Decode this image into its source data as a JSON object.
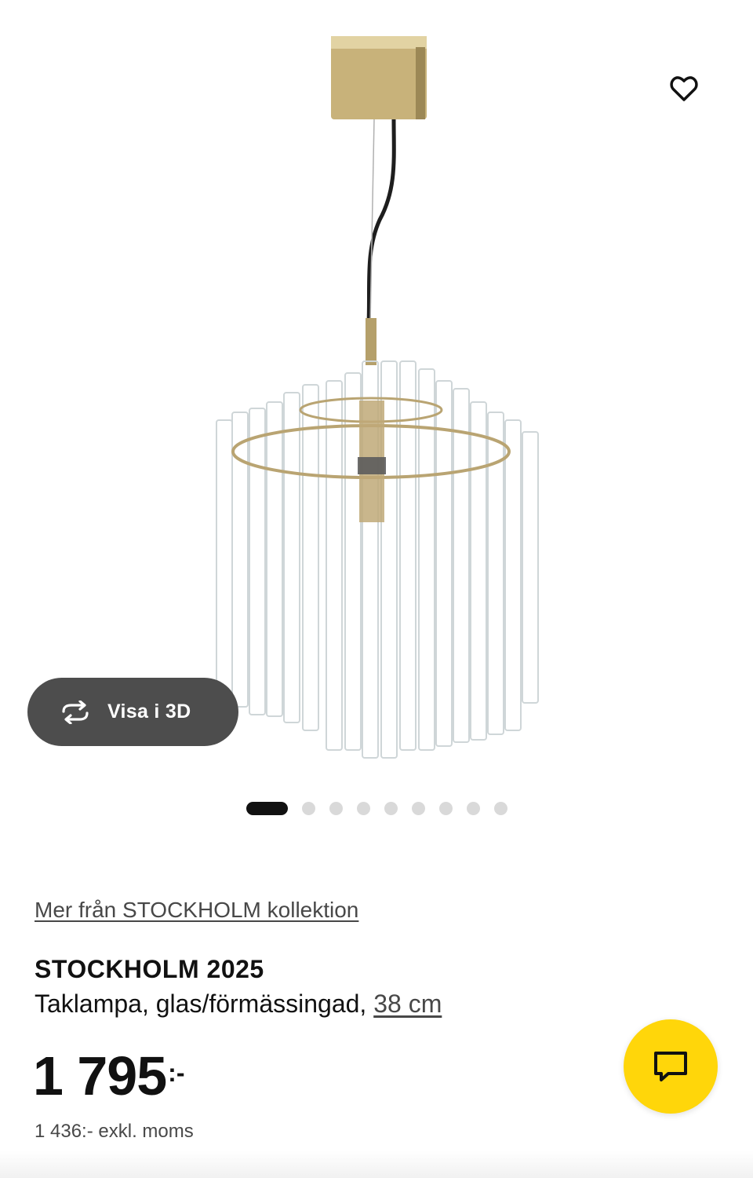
{
  "gallery": {
    "product_image_icon": "pendant-lamp-glass-tubes-image",
    "view_3d_label": "Visa i 3D",
    "view_3d_icon": "rotate-icon",
    "favorite_icon": "heart-icon",
    "dot_count": 9,
    "active_dot_index": 0
  },
  "product": {
    "collection_link": "Mer från STOCKHOLM kollektion",
    "name": "STOCKHOLM 2025",
    "description": "Taklampa, glas/förmässingad, ",
    "size_link": "38 cm",
    "price_integer": "1 795",
    "price_suffix": ":-",
    "price_ex_vat": "1 436:- exkl. moms"
  },
  "chat": {
    "icon": "chat-bubble-icon"
  },
  "colors": {
    "chat_button": "#ffd60a",
    "view_3d_button": "#4d4d4d",
    "link_text": "#484848"
  }
}
